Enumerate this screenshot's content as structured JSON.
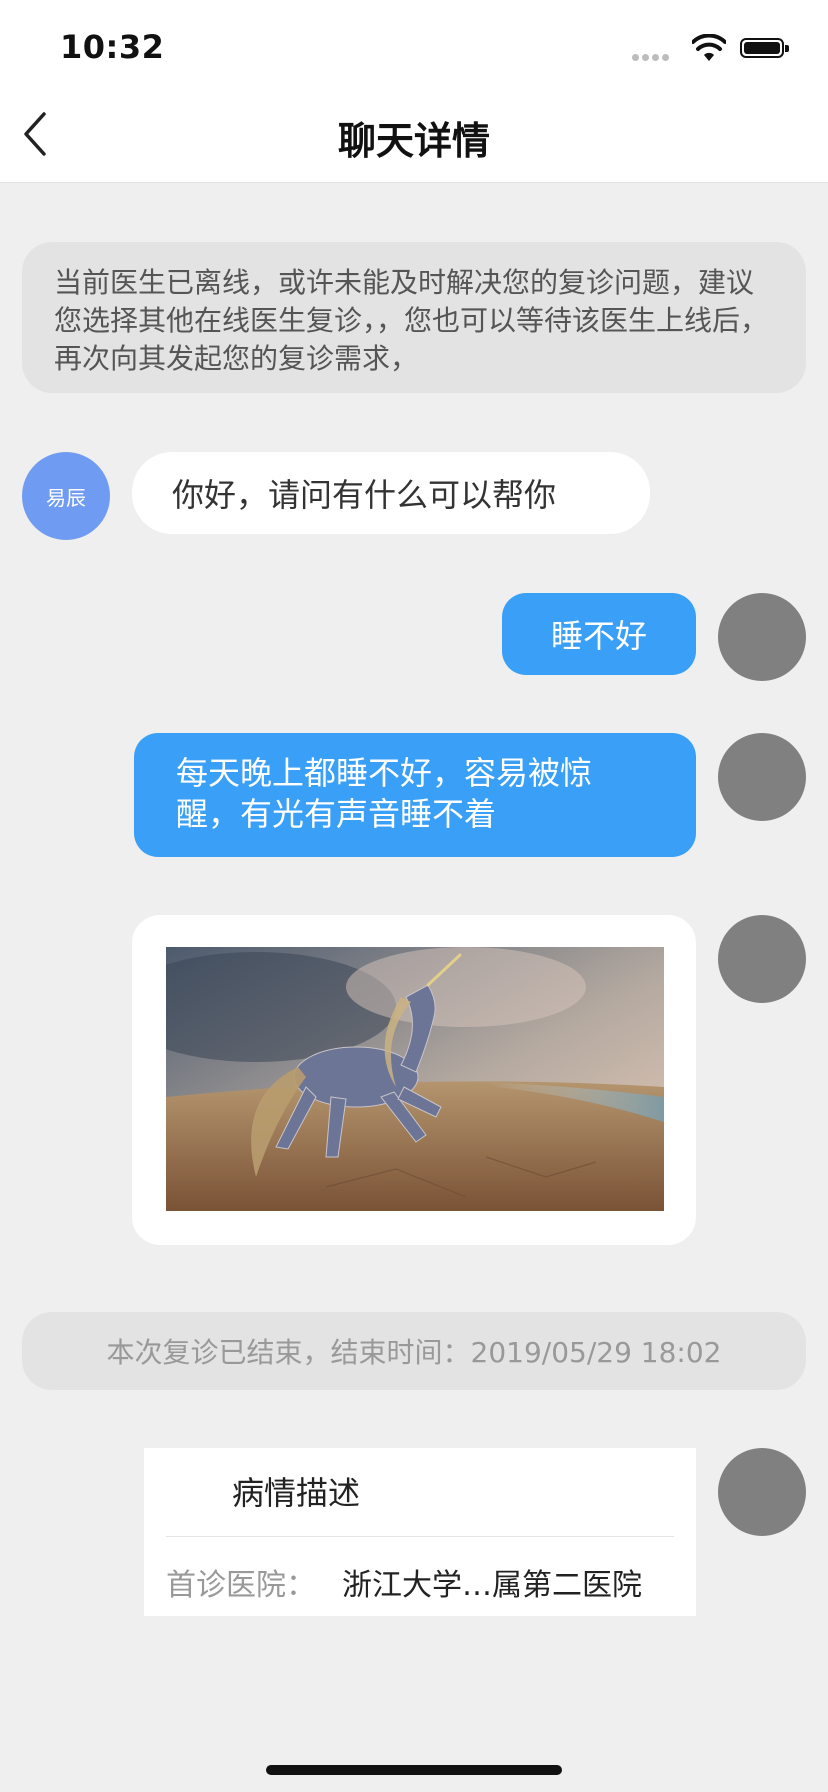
{
  "status_bar": {
    "time": "10:32"
  },
  "nav": {
    "title": "聊天详情"
  },
  "notice": {
    "text": "当前医生已离线，或许未能及时解决您的复诊问题，建议您选择其他在线医生复诊，，您也可以等待该医生上线后，再次向其发起您的复诊需求，"
  },
  "messages": [
    {
      "sender": "doctor",
      "avatar_label": "易辰",
      "text": "你好，请问有什么可以帮你"
    },
    {
      "sender": "patient",
      "text": "睡不好"
    },
    {
      "sender": "patient",
      "text": "每天晚上都睡不好，容易被惊醒，有光有声音睡不着"
    },
    {
      "sender": "patient",
      "type": "image",
      "image": "unicorn-on-beach"
    }
  ],
  "end_note": {
    "text": "本次复诊已结束，结束时间：2019/05/29 18:02"
  },
  "case_card": {
    "title": "病情描述",
    "label": "首诊医院：",
    "value": "浙江大学…属第二医院"
  },
  "icons": {
    "back": "chevron-left-icon",
    "wifi": "wifi-icon",
    "battery": "battery-icon",
    "signal": "signal-dots-icon"
  },
  "colors": {
    "accent_blue": "#3a9ff6",
    "doctor_avatar": "#6f9cf2",
    "background": "#efefef"
  }
}
